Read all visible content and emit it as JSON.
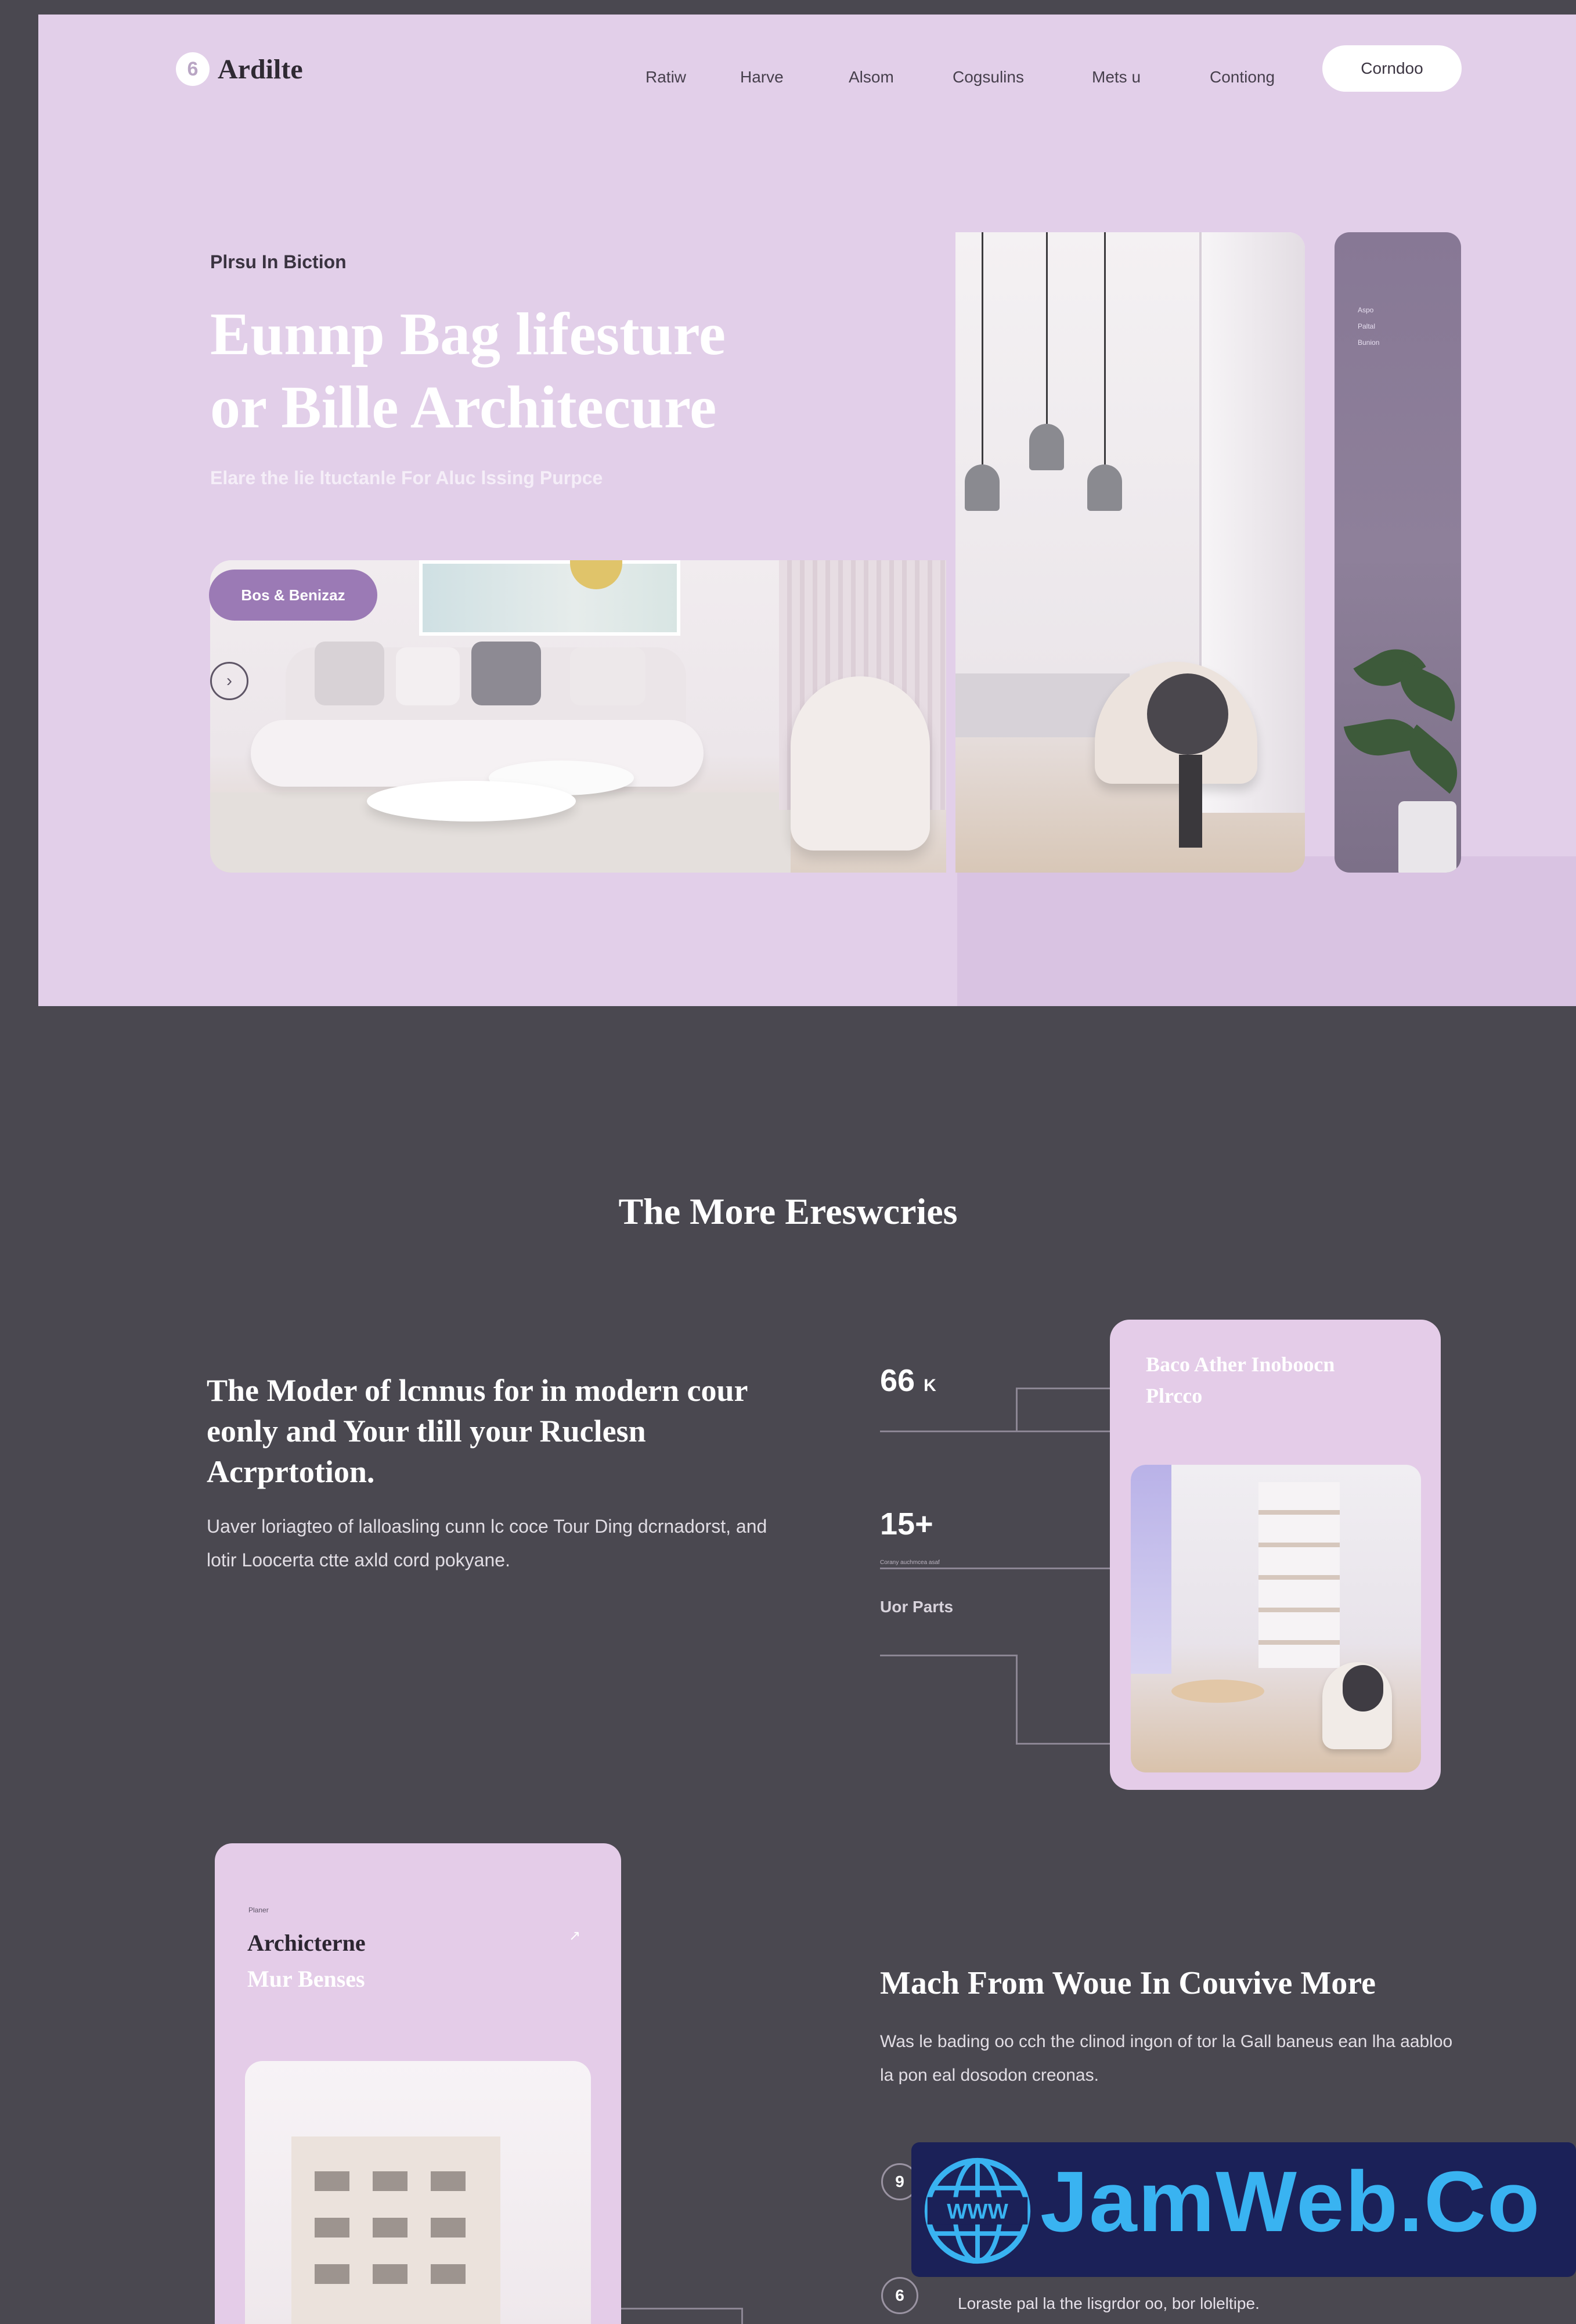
{
  "brand": {
    "logo_mark": "6",
    "name": "Ardilte"
  },
  "nav": {
    "items": [
      "Ratiw",
      "Harve",
      "Alsom",
      "Cogsulins",
      "Mets u",
      "Contiong"
    ],
    "cta": "Corndoo"
  },
  "hero": {
    "eyebrow": "Plrsu In Biction",
    "title_line1": "Eunnp Bag lifesture",
    "title_line2": "or Bille Architecure",
    "subtitle": "Elare the lie ltuctanle For Aluc lssing Purpce",
    "cta": "Bos & Benizaz",
    "side_panel_text": [
      "Aspo",
      "Paltal",
      "Bunion"
    ]
  },
  "section": {
    "title": "The More Ereswcries"
  },
  "feature1": {
    "heading": "The Moder of lcnnus for in modern cour eonly and Your tlill your Ruclesn Acrprtotion.",
    "body": "Uaver loriagteo of lalloasling cunn lc coce Tour Ding dcrnadorst, and lotir Loocerta ctte axld cord pokyane."
  },
  "stats": [
    {
      "value": "66",
      "unit": "K",
      "caption": ""
    },
    {
      "value": "15+",
      "unit": "",
      "tiny": "Corany auchmcea asaf",
      "caption": "Uor Parts"
    }
  ],
  "card1": {
    "title": "Baco Ather Inoboocn Plrcco"
  },
  "card2": {
    "tiny": "Planer",
    "title": "Archicterne",
    "subtitle": "Mur Benses",
    "icon": "arrow-icon"
  },
  "feature2": {
    "heading": "Mach From Woue In Couvive More",
    "body": "Was le bading oo cch the clinod ingon of tor la Gall baneus ean lha aabloo la pon eal dosodon creonas.",
    "steps": [
      {
        "number": "9",
        "text": ""
      },
      {
        "number": "6",
        "text": "Loraste pal la the lisgrdor oo, bor loleltipe."
      }
    ]
  },
  "watermark": {
    "text": "JamWeb.Co",
    "globe_label": "WWW"
  },
  "colors": {
    "hero_bg": "#e2cfe9",
    "dark_bg": "#4a4850",
    "accent": "#9b7ab5",
    "card_bg": "#e4cce8",
    "watermark_text": "#39b3f1"
  }
}
